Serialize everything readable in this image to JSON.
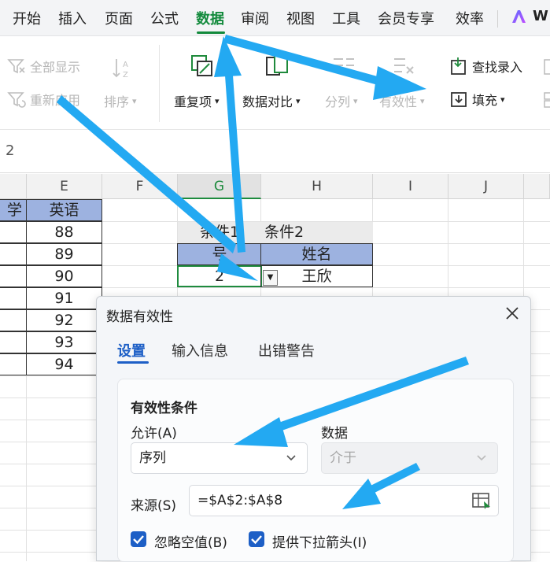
{
  "menu": {
    "items": [
      "开始",
      "插入",
      "页面",
      "公式",
      "数据",
      "审阅",
      "视图",
      "工具",
      "会员专享",
      "效率"
    ],
    "active": "数据",
    "extra": "W"
  },
  "ribbon": {
    "show_all": "全部显示",
    "reapply": "重新应用",
    "sort": "排序",
    "duplicates": "重复项",
    "compare": "数据对比",
    "split": "分列",
    "validation": "有效性",
    "find_entry": "查找录入",
    "fill": "填充"
  },
  "formula_bar": {
    "value": "2"
  },
  "sheet": {
    "columns": [
      "E",
      "F",
      "G",
      "H",
      "I",
      "J"
    ],
    "partial_header_cell": "学",
    "e_header": "英语",
    "e_values": [
      "88",
      "89",
      "90",
      "91",
      "92",
      "93",
      "94"
    ],
    "cond1": "条件1",
    "cond2": "条件2",
    "g_header_partial": "号",
    "h_header": "姓名",
    "g_value": "2",
    "h_value": "王欣"
  },
  "dialog": {
    "title": "数据有效性",
    "tabs": [
      "设置",
      "输入信息",
      "出错警告"
    ],
    "section_title": "有效性条件",
    "allow_label": "允许(A)",
    "allow_value": "序列",
    "data_label": "数据",
    "data_value": "介于",
    "source_label": "来源(S)",
    "source_value": "=$A$2:$A$8",
    "ignore_blank": "忽略空值(B)",
    "dropdown_arrow": "提供下拉箭头(I)"
  },
  "colors": {
    "accent_green": "#128a3c",
    "accent_blue": "#1d5fc6",
    "annotation_arrow": "#23a9f2",
    "header_fill": "#9db2e0"
  }
}
